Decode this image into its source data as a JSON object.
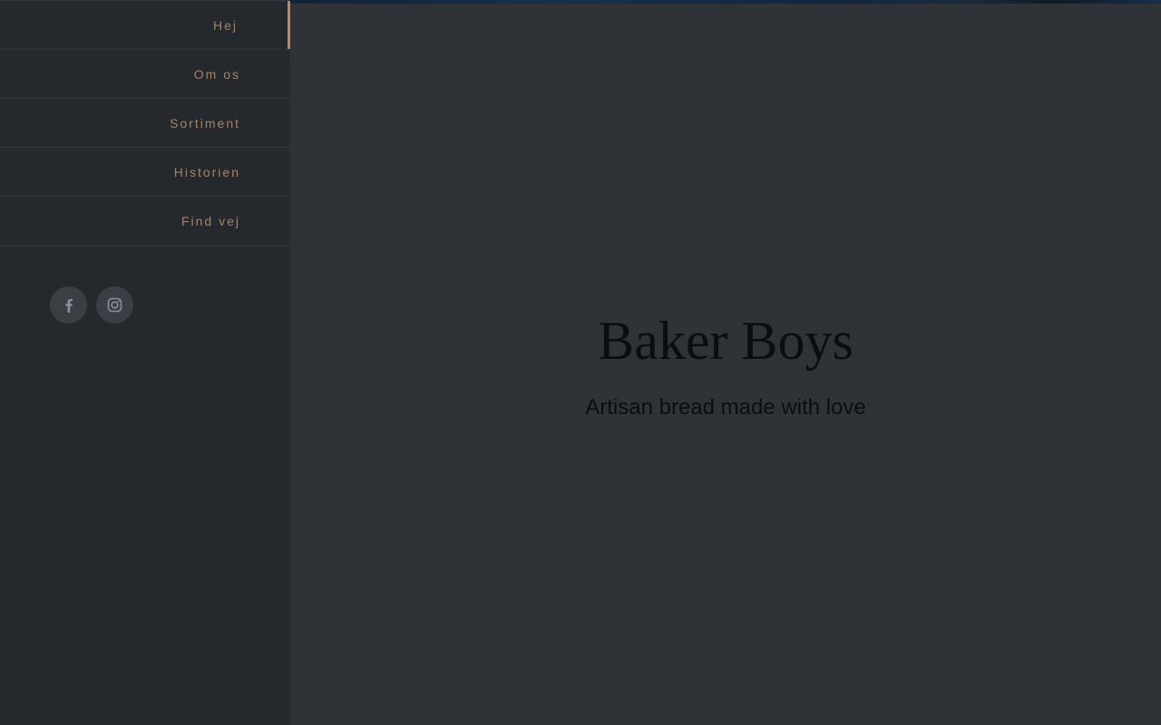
{
  "nav": {
    "items": [
      {
        "label": "Hej",
        "active": true
      },
      {
        "label": "Om os",
        "active": false
      },
      {
        "label": "Sortiment",
        "active": false
      },
      {
        "label": "Historien",
        "active": false
      },
      {
        "label": "Find vej",
        "active": false
      }
    ]
  },
  "social": {
    "icons": [
      "facebook-icon",
      "instagram-icon"
    ]
  },
  "hero": {
    "title": "Baker Boys",
    "subtitle": "Artisan bread made with love"
  },
  "colors": {
    "accent": "#b88a63",
    "nav_text": "#a48466",
    "sidebar_bg": "#25282d",
    "main_bg": "#2f3237"
  }
}
